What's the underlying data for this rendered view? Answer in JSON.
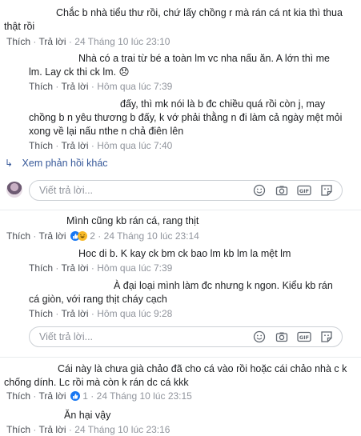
{
  "comments": [
    {
      "line1": "Chắc b nhà tiểu thư rồi, chứ lấy chồng r mà rán cá nt kia thì thua",
      "line2": "thật rồi"
    },
    {
      "line1": "Nhà có a trai từ bé a toàn lm vc nha nấu ăn. A lớn thì me",
      "line2": "lm. Lay ck thi ck lm.",
      "emoji": "😞"
    },
    {
      "line1": "đấy, thì mk nói là b đc chiều quá rồi còn j, may",
      "line2": "chồng b n yêu thương b đấy, k vớ phải thằng n đi làm cả ngày mệt mỏi",
      "line3": "xong về lại nấu nthe n chả điên lên"
    },
    {
      "line1": "Mình cũng kb rán cá, rang thịt"
    },
    {
      "line1": "Hoc di b. K kay ck bm ck bao lm kb lm la mệt lm"
    },
    {
      "line1": "À đại loại mình làm đc nhưng k ngon. Kiểu kb rán",
      "line2": "cá giòn, với rang thịt cháy cạch"
    },
    {
      "line1": "Cái này là chưa già chảo đã cho cá vào rồi hoặc cái chảo nhà c k",
      "line2": "chống dính. Lc rồi mà còn k rán dc cá kkk"
    },
    {
      "line1": "Ăn hại vậy"
    }
  ],
  "actions": {
    "like": "Thích",
    "reply": "Trả lời",
    "dot": "·"
  },
  "times": {
    "t1": "24 Tháng 10 lúc 23:10",
    "t2": "Hôm qua lúc 7:39",
    "t3": "Hôm qua lúc 7:40",
    "t4": "24 Tháng 10 lúc 23:14",
    "t5": "Hôm qua lúc 7:39",
    "t6": "Hôm qua lúc 9:28",
    "t7": "24 Tháng 10 lúc 23:15",
    "t8": "24 Tháng 10 lúc 23:16"
  },
  "reactions": {
    "c4_count": "2",
    "c7_count": "1"
  },
  "more_replies": "Xem phản hồi khác",
  "reply_placeholder": "Viết trả lời...",
  "colors": {
    "link": "#4b4f56",
    "meta": "#90949c",
    "accent": "#365899",
    "like_blue": "#1877f2",
    "haha_yellow": "#f7b928"
  },
  "icons": [
    "smiley-icon",
    "camera-icon",
    "gif-icon",
    "sticker-icon",
    "reply-arrow-icon",
    "like-reaction-icon",
    "haha-reaction-icon"
  ]
}
